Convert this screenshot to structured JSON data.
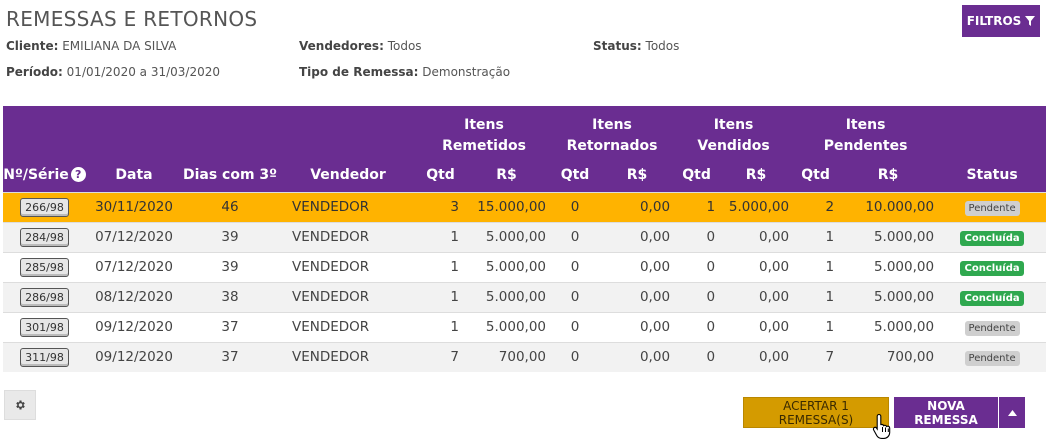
{
  "page": {
    "title": "REMESSAS E RETORNOS",
    "filters_label": "FILTROS"
  },
  "meta": {
    "client_label": "Cliente:",
    "client_value": "EMILIANA DA SILVA",
    "sellers_label": "Vendedores:",
    "sellers_value": "Todos",
    "status_label": "Status:",
    "status_value": "Todos",
    "period_label": "Período:",
    "period_value": "01/01/2020 a 31/03/2020",
    "type_label": "Tipo de Remessa:",
    "type_value": "Demonstração"
  },
  "table": {
    "groups": {
      "sent": "Itens Remetidos",
      "returned": "Itens Retornados",
      "sold": "Itens Vendidos",
      "pending": "Itens Pendentes"
    },
    "columns": {
      "serie": "Nº/Série",
      "date": "Data",
      "days": "Dias com 3º",
      "seller": "Vendedor",
      "qty": "Qtd",
      "brl": "R$",
      "status": "Status"
    },
    "rows": [
      {
        "serie": "266/98",
        "date": "30/11/2020",
        "days": "46",
        "seller": "VENDEDOR",
        "sent_qty": "3",
        "sent_val": "15.000,00",
        "ret_qty": "0",
        "ret_val": "0,00",
        "sold_qty": "1",
        "sold_val": "5.000,00",
        "pend_qty": "2",
        "pend_val": "10.000,00",
        "status": "Pendente",
        "status_kind": "pending",
        "selected": true
      },
      {
        "serie": "284/98",
        "date": "07/12/2020",
        "days": "39",
        "seller": "VENDEDOR",
        "sent_qty": "1",
        "sent_val": "5.000,00",
        "ret_qty": "0",
        "ret_val": "0,00",
        "sold_qty": "0",
        "sold_val": "0,00",
        "pend_qty": "1",
        "pend_val": "5.000,00",
        "status": "Concluída",
        "status_kind": "done",
        "selected": false
      },
      {
        "serie": "285/98",
        "date": "07/12/2020",
        "days": "39",
        "seller": "VENDEDOR",
        "sent_qty": "1",
        "sent_val": "5.000,00",
        "ret_qty": "0",
        "ret_val": "0,00",
        "sold_qty": "0",
        "sold_val": "0,00",
        "pend_qty": "1",
        "pend_val": "5.000,00",
        "status": "Concluída",
        "status_kind": "done",
        "selected": false
      },
      {
        "serie": "286/98",
        "date": "08/12/2020",
        "days": "38",
        "seller": "VENDEDOR",
        "sent_qty": "1",
        "sent_val": "5.000,00",
        "ret_qty": "0",
        "ret_val": "0,00",
        "sold_qty": "0",
        "sold_val": "0,00",
        "pend_qty": "1",
        "pend_val": "5.000,00",
        "status": "Concluída",
        "status_kind": "done",
        "selected": false
      },
      {
        "serie": "301/98",
        "date": "09/12/2020",
        "days": "37",
        "seller": "VENDEDOR",
        "sent_qty": "1",
        "sent_val": "5.000,00",
        "ret_qty": "0",
        "ret_val": "0,00",
        "sold_qty": "0",
        "sold_val": "0,00",
        "pend_qty": "1",
        "pend_val": "5.000,00",
        "status": "Pendente",
        "status_kind": "pending",
        "selected": false
      },
      {
        "serie": "311/98",
        "date": "09/12/2020",
        "days": "37",
        "seller": "VENDEDOR",
        "sent_qty": "7",
        "sent_val": "700,00",
        "ret_qty": "0",
        "ret_val": "0,00",
        "sold_qty": "0",
        "sold_val": "0,00",
        "pend_qty": "7",
        "pend_val": "700,00",
        "status": "Pendente",
        "status_kind": "pending",
        "selected": false
      }
    ]
  },
  "actions": {
    "settle_label": "ACERTAR 1 REMESSA(S)",
    "new_label": "NOVA REMESSA"
  },
  "icons": {
    "filter": "filter-icon",
    "help": "help-circle-icon",
    "settings": "gear-icon",
    "caret": "caret-up-icon",
    "cursor": "hand-pointer-icon"
  },
  "colors": {
    "brand": "#6a2d91",
    "selected_row": "#ffb300",
    "settle_button": "#d49b00",
    "status_done": "#2fa84f",
    "status_pending": "#cfcfcf"
  }
}
